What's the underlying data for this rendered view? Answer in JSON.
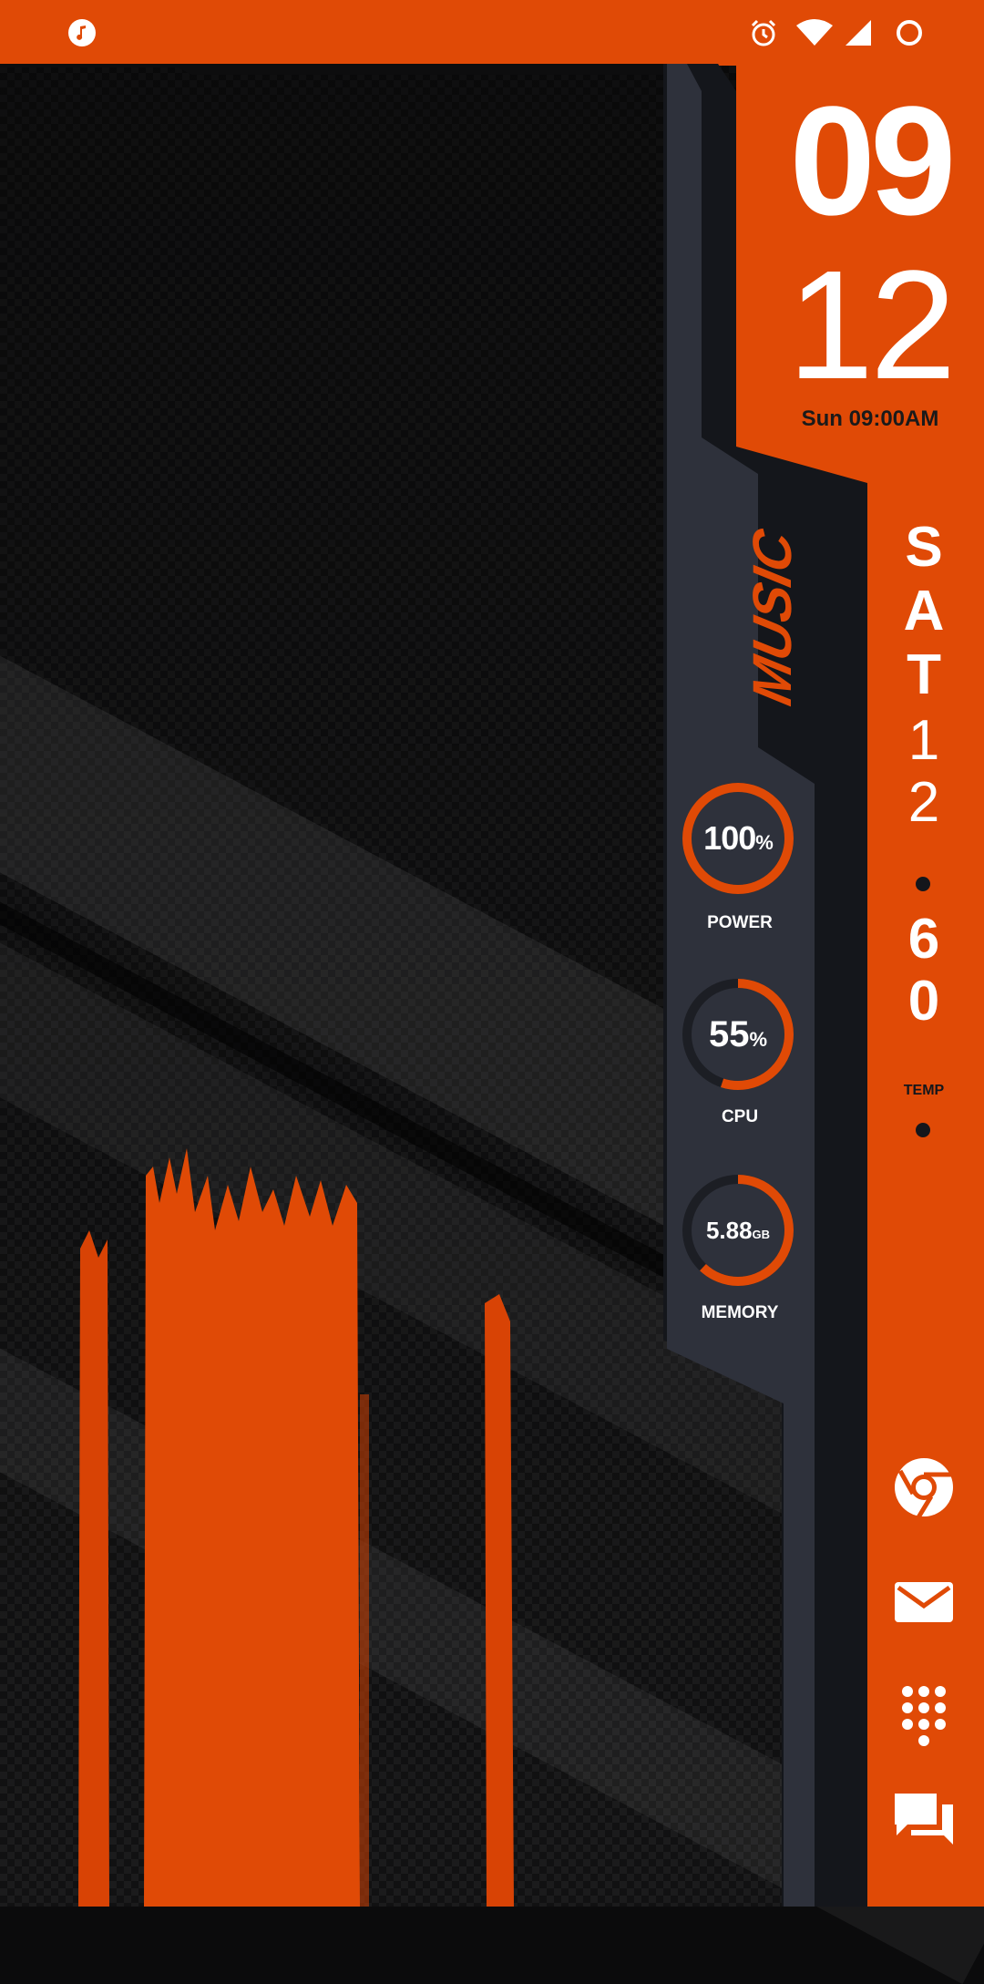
{
  "status_bar": {
    "left_icons": [
      "music-note-icon"
    ],
    "right_icons": [
      "alarm-icon",
      "wifi-icon",
      "signal-icon",
      "battery-circle-icon"
    ]
  },
  "clock": {
    "hour": "09",
    "minute": "12",
    "date_line": "Sun 09:00AM"
  },
  "music_label": "MUSIC",
  "gauges": [
    {
      "name": "power",
      "value": "100",
      "unit": "%",
      "label": "POWER",
      "fraction": 1.0
    },
    {
      "name": "cpu",
      "value": "55",
      "unit": "%",
      "label": "CPU",
      "fraction": 0.55
    },
    {
      "name": "memory",
      "value": "5.88",
      "unit": "GB",
      "label": "MEMORY",
      "fraction": 0.62
    }
  ],
  "side_column": {
    "day": [
      "S",
      "A",
      "T"
    ],
    "date_digits": [
      "1",
      "2"
    ],
    "temp_digits": [
      "6",
      "0"
    ],
    "temp_label": "TEMP"
  },
  "dock": [
    "chrome-icon",
    "mail-icon",
    "dialer-icon",
    "messages-icon"
  ],
  "colors": {
    "accent": "#e04a06",
    "panel": "#2e313b",
    "panel_dark": "#14161b",
    "white": "#ffffff"
  }
}
